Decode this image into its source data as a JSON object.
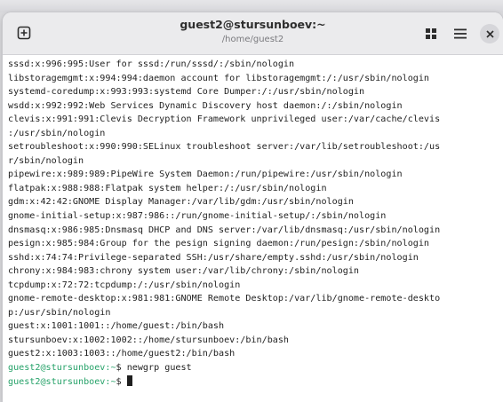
{
  "window": {
    "title": "guest2@stursunboev:~",
    "subtitle": "/home/guest2"
  },
  "icons": {
    "new_tab": "plus-square-icon",
    "view": "grid-icon",
    "menu": "hamburger-menu-icon",
    "close": "close-icon"
  },
  "colors": {
    "prompt": "#26a269",
    "text": "#1f1f1f",
    "background": "#ffffff",
    "header": "#ebebed"
  },
  "terminal": {
    "output_lines": [
      "sssd:x:996:995:User for sssd:/run/sssd/:/sbin/nologin",
      "libstoragemgmt:x:994:994:daemon account for libstoragemgmt:/:/usr/sbin/nologin",
      "systemd-coredump:x:993:993:systemd Core Dumper:/:/usr/sbin/nologin",
      "wsdd:x:992:992:Web Services Dynamic Discovery host daemon:/:/sbin/nologin",
      "clevis:x:991:991:Clevis Decryption Framework unprivileged user:/var/cache/clevis",
      ":/usr/sbin/nologin",
      "setroubleshoot:x:990:990:SELinux troubleshoot server:/var/lib/setroubleshoot:/us",
      "r/sbin/nologin",
      "pipewire:x:989:989:PipeWire System Daemon:/run/pipewire:/usr/sbin/nologin",
      "flatpak:x:988:988:Flatpak system helper:/:/usr/sbin/nologin",
      "gdm:x:42:42:GNOME Display Manager:/var/lib/gdm:/usr/sbin/nologin",
      "gnome-initial-setup:x:987:986::/run/gnome-initial-setup/:/sbin/nologin",
      "dnsmasq:x:986:985:Dnsmasq DHCP and DNS server:/var/lib/dnsmasq:/usr/sbin/nologin",
      "pesign:x:985:984:Group for the pesign signing daemon:/run/pesign:/sbin/nologin",
      "sshd:x:74:74:Privilege-separated SSH:/usr/share/empty.sshd:/usr/sbin/nologin",
      "chrony:x:984:983:chrony system user:/var/lib/chrony:/sbin/nologin",
      "tcpdump:x:72:72:tcpdump:/:/usr/sbin/nologin",
      "gnome-remote-desktop:x:981:981:GNOME Remote Desktop:/var/lib/gnome-remote-deskto",
      "p:/usr/sbin/nologin",
      "guest:x:1001:1001::/home/guest:/bin/bash",
      "stursunboev:x:1002:1002::/home/stursunboev:/bin/bash",
      "guest2:x:1003:1003::/home/guest2:/bin/bash"
    ],
    "prompt_user_host": "guest2@stursunboev",
    "prompt_path": ":~",
    "prompt_symbol": "$",
    "command_1": "newgrp guest",
    "command_2": ""
  }
}
